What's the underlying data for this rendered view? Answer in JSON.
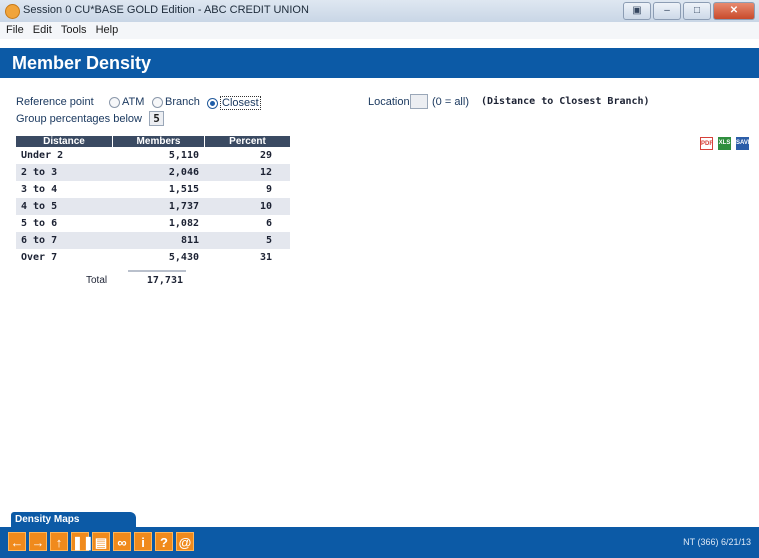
{
  "window": {
    "title": "Session 0 CU*BASE GOLD Edition - ABC CREDIT UNION"
  },
  "menu": [
    "File",
    "Edit",
    "Tools",
    "Help"
  ],
  "header": {
    "title": "Member Density"
  },
  "form": {
    "reference_point_label": "Reference point",
    "options": [
      "ATM",
      "Branch",
      "Closest"
    ],
    "selected_option": "Closest",
    "group_label": "Group percentages below",
    "group_value": "5",
    "location_label": "Location",
    "location_value": "",
    "location_hint": "(0 = all)",
    "location_desc": "(Distance to Closest Branch)"
  },
  "table": {
    "headers": [
      "Distance",
      "Members",
      "Percent"
    ],
    "rows": [
      {
        "distance": "Under 2",
        "members": "5,110",
        "percent": "29"
      },
      {
        "distance": "2 to 3",
        "members": "2,046",
        "percent": "12"
      },
      {
        "distance": "3 to 4",
        "members": "1,515",
        "percent": "9"
      },
      {
        "distance": "4 to 5",
        "members": "1,737",
        "percent": "10"
      },
      {
        "distance": "5 to 6",
        "members": "1,082",
        "percent": "6"
      },
      {
        "distance": "6 to 7",
        "members": "811",
        "percent": "5"
      },
      {
        "distance": "Over 7",
        "members": "5,430",
        "percent": "31"
      }
    ],
    "total_label": "Total",
    "total_value": "17,731"
  },
  "export_icons": {
    "pdf": "PDF",
    "xls": "XLS",
    "save": "SAVE"
  },
  "tabs": {
    "density_maps": "Density Maps"
  },
  "nav_icons": [
    "back-arrow-icon",
    "forward-arrow-icon",
    "up-arrow-icon",
    "pause-icon",
    "print-icon",
    "link-icon",
    "info-icon",
    "help-icon",
    "at-icon"
  ],
  "footer": {
    "code": "NT (366) 6/21/13"
  },
  "colors": {
    "brand_blue": "#0c5aa6",
    "nav_orange": "#f08a1c",
    "table_header": "#3a4a62"
  }
}
